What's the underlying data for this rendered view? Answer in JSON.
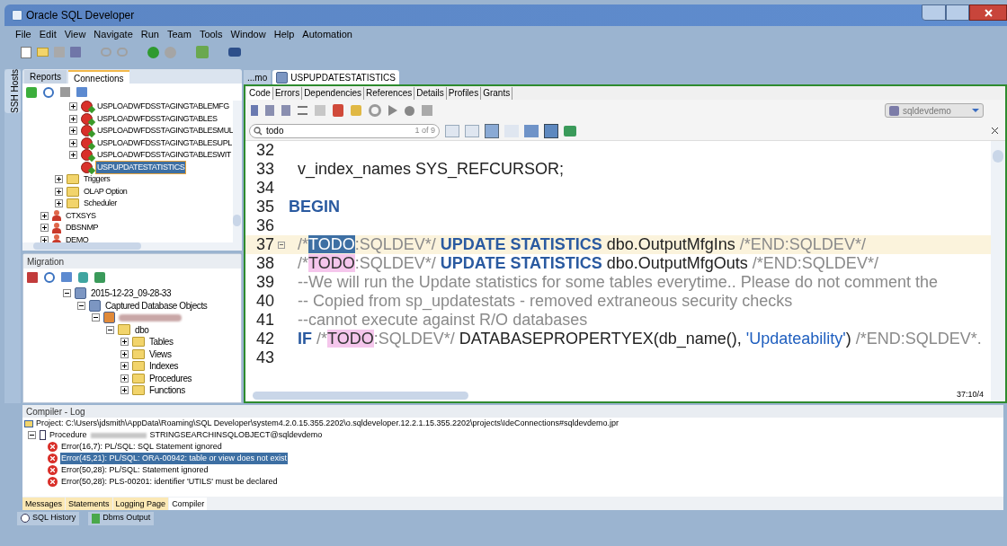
{
  "window": {
    "title": "Oracle SQL Developer"
  },
  "menu": [
    "File",
    "Edit",
    "View",
    "Navigate",
    "Run",
    "Team",
    "Tools",
    "Window",
    "Help",
    "Automation"
  ],
  "side_strip": {
    "label": "SSH Hosts"
  },
  "connections_panel": {
    "tabs": [
      {
        "label": "Reports",
        "selected": false
      },
      {
        "label": "Connections",
        "selected": true
      }
    ],
    "tree": [
      {
        "children": [
          {
            "children": [
              {
                "label": "USPLOADWFDSSTAGINGTABLEMFG",
                "kind": "proc-error",
                "expanded": false,
                "selected": false
              },
              {
                "label": "USPLOADWFDSSTAGINGTABLES",
                "kind": "proc-error",
                "expanded": false,
                "selected": false
              },
              {
                "label": "USPLOADWFDSSTAGINGTABLESMUL",
                "kind": "proc-error",
                "expanded": false,
                "selected": false
              },
              {
                "label": "USPLOADWFDSSTAGINGTABLESUPL",
                "kind": "proc-error",
                "expanded": false,
                "selected": false
              },
              {
                "label": "USPLOADWFDSSTAGINGTABLESWIT",
                "kind": "proc-error",
                "expanded": false,
                "selected": false
              },
              {
                "label": "USPUPDATESTATISTICS",
                "kind": "proc-error",
                "selected": true
              }
            ]
          },
          {
            "label": "Triggers",
            "kind": "folder",
            "expanded": false,
            "selected": false
          },
          {
            "label": "OLAP Option",
            "kind": "folder",
            "expanded": false,
            "selected": false
          },
          {
            "label": "Scheduler",
            "kind": "folder",
            "expanded": false,
            "selected": false
          }
        ]
      },
      {
        "label": "CTXSYS",
        "kind": "user",
        "expanded": false,
        "selected": false
      },
      {
        "label": "DBSNMP",
        "kind": "user",
        "expanded": false,
        "selected": false
      },
      {
        "label": "DEMO",
        "kind": "user",
        "expanded": false,
        "selected": false
      }
    ]
  },
  "migration_panel": {
    "title": "Migration",
    "tree": [
      {
        "children": [
          {
            "label": "2015-12-23_09-28-33",
            "kind": "db",
            "expanded": true,
            "selected": false,
            "children": [
              {
                "label": "Captured Database Objects",
                "kind": "db",
                "expanded": true,
                "selected": false,
                "children": [
                  {
                    "kind": "blurred",
                    "expanded": true,
                    "selected": false,
                    "children": [
                      {
                        "label": "dbo",
                        "kind": "schema",
                        "expanded": true,
                        "selected": false,
                        "children": [
                          {
                            "label": "Tables",
                            "kind": "folder",
                            "expanded": false,
                            "selected": false
                          },
                          {
                            "label": "Views",
                            "kind": "folder",
                            "expanded": false,
                            "selected": false
                          },
                          {
                            "label": "Indexes",
                            "kind": "folder",
                            "expanded": false,
                            "selected": false
                          },
                          {
                            "label": "Procedures",
                            "kind": "folder",
                            "expanded": false,
                            "selected": false
                          },
                          {
                            "label": "Functions",
                            "kind": "folder",
                            "expanded": false,
                            "selected": false
                          }
                        ]
                      }
                    ]
                  }
                ]
              }
            ]
          }
        ]
      }
    ]
  },
  "editor": {
    "tabs": [
      {
        "label": "...mo",
        "selected": false
      },
      {
        "label": "USPUPDATESTATISTICS",
        "selected": true
      }
    ],
    "subtabs": [
      {
        "label": "Code",
        "selected": true
      },
      {
        "label": "Errors",
        "selected": false
      },
      {
        "label": "Dependencies",
        "selected": false
      },
      {
        "label": "References",
        "selected": false
      },
      {
        "label": "Details",
        "selected": false
      },
      {
        "label": "Profiles",
        "selected": false
      },
      {
        "label": "Grants",
        "selected": false
      }
    ],
    "connection": "sqldevdemo",
    "search": {
      "value": "todo",
      "count": "1 of 9"
    },
    "lines": [
      {
        "number": "32",
        "current": false
      },
      {
        "number": "33",
        "current": false,
        "segments": [
          {
            "kind": "plain",
            "text": "  v_index_names SYS_REFCURSOR;"
          }
        ]
      },
      {
        "number": "34",
        "current": false
      },
      {
        "number": "35",
        "current": false,
        "segments": [
          {
            "kind": "keyword",
            "text": "BEGIN"
          }
        ]
      },
      {
        "number": "36",
        "current": false
      },
      {
        "number": "37",
        "current": true,
        "fold": true,
        "segments": [
          {
            "kind": "comment",
            "text": "  /*"
          },
          {
            "kind": "todo-current",
            "text": "TODO"
          },
          {
            "kind": "comment",
            "text": ":SQLDEV*/ "
          },
          {
            "kind": "keyword",
            "text": "UPDATE STATISTICS "
          },
          {
            "kind": "plain",
            "text": "dbo.OutputMfgIns "
          },
          {
            "kind": "comment",
            "text": "/*END:SQLDEV*/"
          }
        ]
      },
      {
        "number": "38",
        "current": false,
        "segments": [
          {
            "kind": "comment",
            "text": "  /*"
          },
          {
            "kind": "todo",
            "text": "TODO"
          },
          {
            "kind": "comment",
            "text": ":SQLDEV*/ "
          },
          {
            "kind": "keyword",
            "text": "UPDATE STATISTICS "
          },
          {
            "kind": "plain",
            "text": "dbo.OutputMfgOuts "
          },
          {
            "kind": "comment",
            "text": "/*END:SQLDEV*/"
          }
        ]
      },
      {
        "number": "39",
        "current": false,
        "segments": [
          {
            "kind": "comment",
            "text": "  --We will run the Update statistics for some tables everytime.. Please do not comment the"
          }
        ]
      },
      {
        "number": "40",
        "current": false,
        "segments": [
          {
            "kind": "comment",
            "text": "  -- Copied from sp_updatestats - removed extraneous security checks"
          }
        ]
      },
      {
        "number": "41",
        "current": false,
        "segments": [
          {
            "kind": "comment",
            "text": "  --cannot execute against R/O databases"
          }
        ]
      },
      {
        "number": "42",
        "current": false,
        "segments": [
          {
            "kind": "keyword",
            "text": "  IF "
          },
          {
            "kind": "comment",
            "text": "/*"
          },
          {
            "kind": "todo",
            "text": "TODO"
          },
          {
            "kind": "comment",
            "text": ":SQLDEV*/ "
          },
          {
            "kind": "plain",
            "text": "DATABASEPROPERTYEX(db_name(), "
          },
          {
            "kind": "string",
            "text": "'Updateability'"
          },
          {
            "kind": "plain",
            "text": ") "
          },
          {
            "kind": "comment",
            "text": "/*END:SQLDEV*."
          }
        ]
      },
      {
        "number": "43",
        "current": false
      }
    ],
    "position": "37:10/4"
  },
  "log": {
    "title": "Compiler - Log",
    "project": "Project: C:\\Users\\jdsmith\\AppData\\Roaming\\SQL Developer\\system4.2.0.15.355.2202\\o.sqldeveloper.12.2.1.15.355.2202\\projects\\IdeConnections#sqldevdemo.jpr",
    "procedure": {
      "prefix": "Procedure",
      "suffix": "STRINGSEARCHINSQLOBJECT@sqldevdemo",
      "expanded": true
    },
    "errors": [
      {
        "text": "Error(16,7): PL/SQL: SQL Statement ignored",
        "selected": false
      },
      {
        "text": "Error(45,21): PL/SQL: ORA-00942: table or view does not exist",
        "selected": true
      },
      {
        "text": "Error(50,28): PL/SQL: Statement ignored",
        "selected": false
      },
      {
        "text": "Error(50,28): PLS-00201: identifier 'UTILS' must be declared",
        "selected": false
      }
    ],
    "tabs": [
      {
        "label": "Messages",
        "selected": false
      },
      {
        "label": "Statements",
        "selected": false
      },
      {
        "label": "Logging Page",
        "selected": false
      },
      {
        "label": "Compiler",
        "selected": true
      }
    ]
  },
  "bottom_tabs": [
    "SQL History",
    "Dbms Output"
  ]
}
